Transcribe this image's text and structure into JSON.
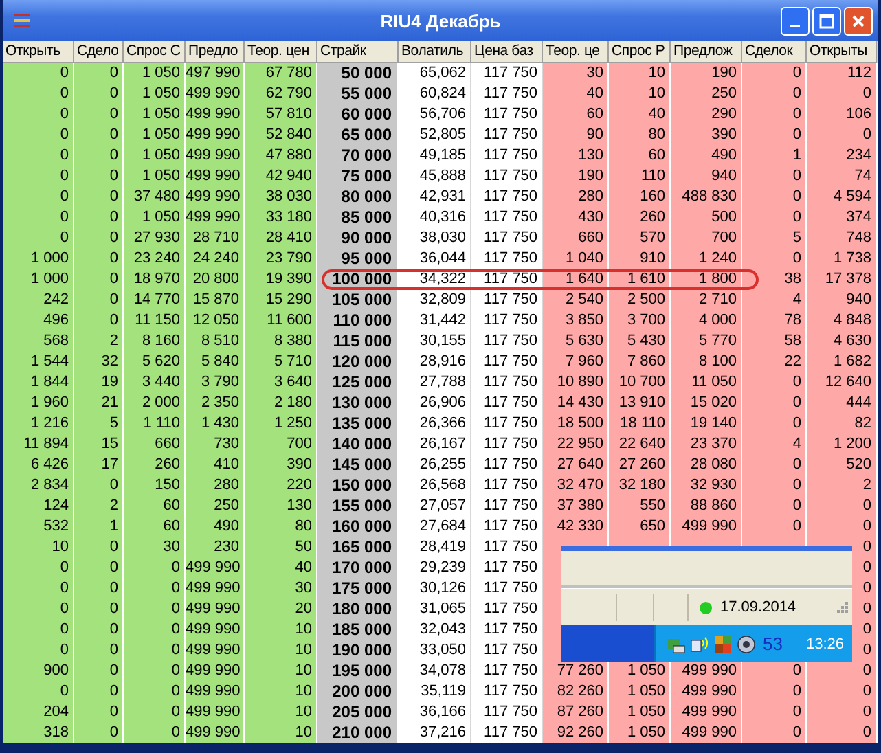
{
  "window": {
    "title": "RIU4 Декабрь"
  },
  "table": {
    "columns": [
      {
        "label": "Открыть",
        "kind": "call"
      },
      {
        "label": "Сдело",
        "kind": "call"
      },
      {
        "label": "Спрос С",
        "kind": "call"
      },
      {
        "label": "Предло",
        "kind": "call"
      },
      {
        "label": "Теор. цен",
        "kind": "call"
      },
      {
        "label": "Страйк",
        "kind": "strike"
      },
      {
        "label": "Волатиль",
        "kind": "info"
      },
      {
        "label": "Цена баз",
        "kind": "info"
      },
      {
        "label": "Теор. це",
        "kind": "put"
      },
      {
        "label": "Спрос Р",
        "kind": "put"
      },
      {
        "label": "Предлож",
        "kind": "put"
      },
      {
        "label": "Сделок",
        "kind": "put"
      },
      {
        "label": "Открыты",
        "kind": "put"
      }
    ],
    "rows": [
      {
        "circled": false,
        "cells": [
          "0",
          "0",
          "1 050",
          "497 990",
          "67 780",
          "50 000",
          "65,062",
          "117 750",
          "30",
          "10",
          "190",
          "0",
          "112"
        ]
      },
      {
        "circled": false,
        "cells": [
          "0",
          "0",
          "1 050",
          "499 990",
          "62 790",
          "55 000",
          "60,824",
          "117 750",
          "40",
          "10",
          "250",
          "0",
          "0"
        ]
      },
      {
        "circled": false,
        "cells": [
          "0",
          "0",
          "1 050",
          "499 990",
          "57 810",
          "60 000",
          "56,706",
          "117 750",
          "60",
          "40",
          "290",
          "0",
          "106"
        ]
      },
      {
        "circled": false,
        "cells": [
          "0",
          "0",
          "1 050",
          "499 990",
          "52 840",
          "65 000",
          "52,805",
          "117 750",
          "90",
          "80",
          "390",
          "0",
          "0"
        ]
      },
      {
        "circled": false,
        "cells": [
          "0",
          "0",
          "1 050",
          "499 990",
          "47 880",
          "70 000",
          "49,185",
          "117 750",
          "130",
          "60",
          "490",
          "1",
          "234"
        ]
      },
      {
        "circled": false,
        "cells": [
          "0",
          "0",
          "1 050",
          "499 990",
          "42 940",
          "75 000",
          "45,888",
          "117 750",
          "190",
          "110",
          "940",
          "0",
          "74"
        ]
      },
      {
        "circled": false,
        "cells": [
          "0",
          "0",
          "37 480",
          "499 990",
          "38 030",
          "80 000",
          "42,931",
          "117 750",
          "280",
          "160",
          "488 830",
          "0",
          "4 594"
        ]
      },
      {
        "circled": false,
        "cells": [
          "0",
          "0",
          "1 050",
          "499 990",
          "33 180",
          "85 000",
          "40,316",
          "117 750",
          "430",
          "260",
          "500",
          "0",
          "374"
        ]
      },
      {
        "circled": false,
        "cells": [
          "0",
          "0",
          "27 930",
          "28 710",
          "28 410",
          "90 000",
          "38,030",
          "117 750",
          "660",
          "570",
          "700",
          "5",
          "748"
        ]
      },
      {
        "circled": false,
        "cells": [
          "1 000",
          "0",
          "23 240",
          "24 240",
          "23 790",
          "95 000",
          "36,044",
          "117 750",
          "1 040",
          "910",
          "1 240",
          "0",
          "1 738"
        ]
      },
      {
        "circled": true,
        "cells": [
          "1 000",
          "0",
          "18 970",
          "20 800",
          "19 390",
          "100 000",
          "34,322",
          "117 750",
          "1 640",
          "1 610",
          "1 800",
          "38",
          "17 378"
        ]
      },
      {
        "circled": false,
        "cells": [
          "242",
          "0",
          "14 770",
          "15 870",
          "15 290",
          "105 000",
          "32,809",
          "117 750",
          "2 540",
          "2 500",
          "2 710",
          "4",
          "940"
        ]
      },
      {
        "circled": false,
        "cells": [
          "496",
          "0",
          "11 150",
          "12 050",
          "11 600",
          "110 000",
          "31,442",
          "117 750",
          "3 850",
          "3 700",
          "4 000",
          "78",
          "4 848"
        ]
      },
      {
        "circled": false,
        "cells": [
          "568",
          "2",
          "8 160",
          "8 510",
          "8 380",
          "115 000",
          "30,155",
          "117 750",
          "5 630",
          "5 430",
          "5 770",
          "58",
          "4 630"
        ]
      },
      {
        "circled": false,
        "cells": [
          "1 544",
          "32",
          "5 620",
          "5 840",
          "5 710",
          "120 000",
          "28,916",
          "117 750",
          "7 960",
          "7 860",
          "8 100",
          "22",
          "1 682"
        ]
      },
      {
        "circled": false,
        "cells": [
          "1 844",
          "19",
          "3 440",
          "3 790",
          "3 640",
          "125 000",
          "27,788",
          "117 750",
          "10 890",
          "10 700",
          "11 050",
          "0",
          "12 640"
        ]
      },
      {
        "circled": false,
        "cells": [
          "1 960",
          "21",
          "2 000",
          "2 350",
          "2 180",
          "130 000",
          "26,906",
          "117 750",
          "14 430",
          "13 910",
          "15 020",
          "0",
          "444"
        ]
      },
      {
        "circled": false,
        "cells": [
          "1 216",
          "5",
          "1 110",
          "1 430",
          "1 250",
          "135 000",
          "26,366",
          "117 750",
          "18 500",
          "18 110",
          "19 140",
          "0",
          "82"
        ]
      },
      {
        "circled": false,
        "cells": [
          "11 894",
          "15",
          "660",
          "730",
          "700",
          "140 000",
          "26,167",
          "117 750",
          "22 950",
          "22 640",
          "23 370",
          "4",
          "1 200"
        ]
      },
      {
        "circled": false,
        "cells": [
          "6 426",
          "17",
          "260",
          "410",
          "390",
          "145 000",
          "26,255",
          "117 750",
          "27 640",
          "27 260",
          "28 080",
          "0",
          "520"
        ]
      },
      {
        "circled": false,
        "cells": [
          "2 834",
          "0",
          "150",
          "280",
          "220",
          "150 000",
          "26,568",
          "117 750",
          "32 470",
          "32 180",
          "32 930",
          "0",
          "2"
        ]
      },
      {
        "circled": false,
        "cells": [
          "124",
          "2",
          "60",
          "250",
          "130",
          "155 000",
          "27,057",
          "117 750",
          "37 380",
          "550",
          "88 860",
          "0",
          "0"
        ]
      },
      {
        "circled": false,
        "cells": [
          "532",
          "1",
          "60",
          "490",
          "80",
          "160 000",
          "27,684",
          "117 750",
          "42 330",
          "650",
          "499 990",
          "0",
          "0"
        ]
      },
      {
        "circled": false,
        "cells": [
          "10",
          "0",
          "30",
          "230",
          "50",
          "165 000",
          "28,419",
          "117 750",
          null,
          null,
          null,
          null,
          "0"
        ]
      },
      {
        "circled": false,
        "cells": [
          "0",
          "0",
          "0",
          "499 990",
          "40",
          "170 000",
          "29,239",
          "117 750",
          null,
          null,
          null,
          null,
          "0"
        ]
      },
      {
        "circled": false,
        "cells": [
          "0",
          "0",
          "0",
          "499 990",
          "30",
          "175 000",
          "30,126",
          "117 750",
          null,
          null,
          null,
          null,
          "0"
        ]
      },
      {
        "circled": false,
        "cells": [
          "0",
          "0",
          "0",
          "499 990",
          "20",
          "180 000",
          "31,065",
          "117 750",
          null,
          null,
          null,
          null,
          "0"
        ]
      },
      {
        "circled": false,
        "cells": [
          "0",
          "0",
          "0",
          "499 990",
          "10",
          "185 000",
          "32,043",
          "117 750",
          null,
          null,
          null,
          null,
          "0"
        ]
      },
      {
        "circled": false,
        "cells": [
          "0",
          "0",
          "0",
          "499 990",
          "10",
          "190 000",
          "33,050",
          "117 750",
          null,
          null,
          null,
          null,
          "0"
        ]
      },
      {
        "circled": false,
        "cells": [
          "900",
          "0",
          "0",
          "499 990",
          "10",
          "195 000",
          "34,078",
          "117 750",
          "77 260",
          "1 050",
          "499 990",
          "0",
          "0"
        ]
      },
      {
        "circled": false,
        "cells": [
          "0",
          "0",
          "0",
          "499 990",
          "10",
          "200 000",
          "35,119",
          "117 750",
          "82 260",
          "1 050",
          "499 990",
          "0",
          "0"
        ]
      },
      {
        "circled": false,
        "cells": [
          "204",
          "0",
          "0",
          "499 990",
          "10",
          "205 000",
          "36,166",
          "117 750",
          "87 260",
          "1 050",
          "499 990",
          "0",
          "0"
        ]
      },
      {
        "circled": false,
        "cells": [
          "318",
          "0",
          "0",
          "499 990",
          "10",
          "210 000",
          "37,216",
          "117 750",
          "92 260",
          "1 050",
          "499 990",
          "0",
          "0"
        ]
      }
    ]
  },
  "overlay": {
    "status_date": "17.09.2014",
    "tray_count": "53",
    "clock": "13:26"
  }
}
